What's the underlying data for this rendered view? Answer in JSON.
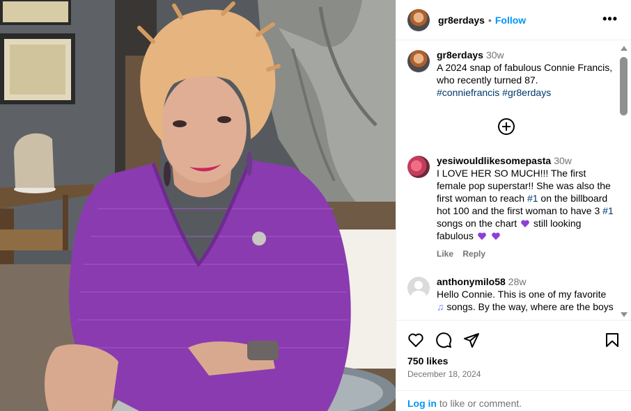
{
  "post": {
    "username": "gr8erdays",
    "follow_label": "Follow",
    "separator": "•",
    "more_label": "•••"
  },
  "caption": {
    "username": "gr8erdays",
    "time": "30w",
    "text": "A 2024 snap of fabulous Connie Francis, who recently turned 87.",
    "hashtags": "#conniefrancis #gr8erdays"
  },
  "comments": [
    {
      "username": "yesiwouldlikesomepasta",
      "time": "30w",
      "text_1": "I LOVE HER SO MUCH!!! The first female pop superstar!! She was also the first woman to reach ",
      "tag_1": "#1",
      "text_2": " on the billboard hot 100 and the first woman to have 3 ",
      "tag_2": "#1",
      "text_3": " songs on the chart ",
      "text_4": " still looking fabulous",
      "like_label": "Like",
      "reply_label": "Reply"
    },
    {
      "username": "anthonymilo58",
      "time": "28w",
      "text_1": "Hello Connie. This is one of my favorite ",
      "text_2": " songs. By the way, where are the boys"
    }
  ],
  "actions": {
    "likes": "750 likes",
    "date": "December 18, 2024",
    "login_link": "Log in",
    "login_text": " to like or comment."
  },
  "colors": {
    "follow": "#0095f6",
    "hashtag": "#00376b",
    "secondary_text": "#737373",
    "heart_emoji": "#8e3fd8",
    "sweater": "#8a3bb0"
  },
  "icons": {
    "header_more": "more-horizontal-icon",
    "add_comment": "plus-circle-icon",
    "like": "heart-icon",
    "comment": "comment-bubble-icon",
    "share": "send-paper-plane-icon",
    "save": "bookmark-icon",
    "heart_emoji": "purple-heart-emoji",
    "music_emoji": "music-note-emoji"
  }
}
